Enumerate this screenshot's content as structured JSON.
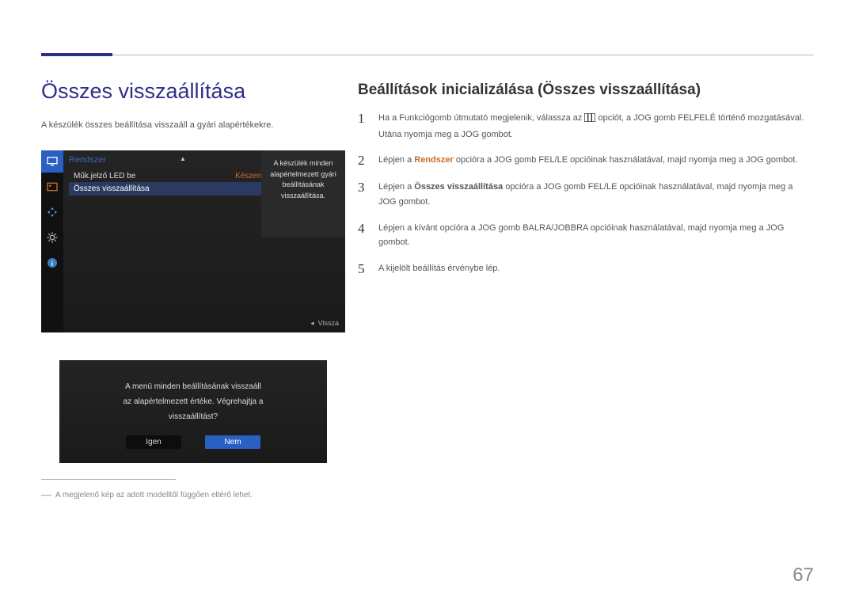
{
  "page": {
    "main_title": "Összes visszaállítása",
    "description": "A készülék összes beállítása visszaáll a gyári alapértékekre.",
    "section_title": "Beállítások inicializálása (Összes visszaállítása)",
    "page_number": "67",
    "footnote": "A megjelenő kép az adott modelltől függően eltérő lehet."
  },
  "menu1": {
    "breadcrumb": "Rendszer",
    "row1_label": "Műk.jelző LED be",
    "row1_value": "Készenlét",
    "row2_label": "Összes visszaállítása",
    "tooltip": "A készülék minden alapértelmezett gyári beállításának visszaállítása.",
    "back_label": "Vissza",
    "back_arrow": "◂"
  },
  "menu2": {
    "message_l1": "A menü minden beállításának visszaáll",
    "message_l2": "az alapértelmezett értéke. Végrehajtja a",
    "message_l3": "visszaállítást?",
    "yes": "Igen",
    "no": "Nem"
  },
  "steps": {
    "s1a": "Ha a Funkciógomb útmutató megjelenik, válassza az ",
    "s1b": " opciót, a JOG gomb FELFELÉ történő mozgatásával. Utána nyomja meg a JOG gombot.",
    "s2a": "Lépjen a ",
    "s2_hl": "Rendszer",
    "s2b": " opcióra a JOG gomb FEL/LE opcióinak használatával, majd nyomja meg a JOG gombot.",
    "s3a": "Lépjen a ",
    "s3_hl": "Összes visszaállítása",
    "s3b": " opcióra a JOG gomb FEL/LE opcióinak használatával, majd nyomja meg a JOG gombot.",
    "s4": "Lépjen a kívánt opcióra a JOG gomb BALRA/JOBBRA opcióinak használatával, majd nyomja meg a JOG gombot.",
    "s5": "A kijelölt beállítás érvénybe lép."
  }
}
